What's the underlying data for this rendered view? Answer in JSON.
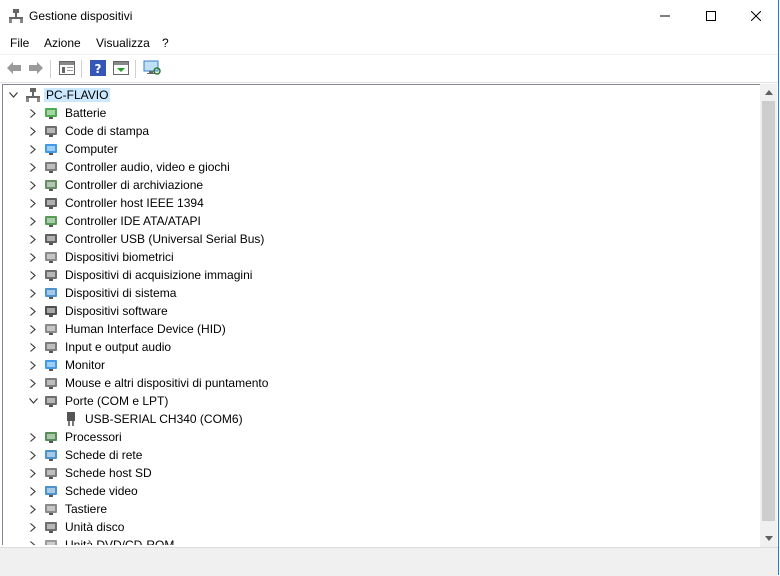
{
  "window": {
    "title": "Gestione dispositivi"
  },
  "menu": {
    "file": "File",
    "azione": "Azione",
    "visualizza": "Visualizza",
    "help": "?"
  },
  "toolbar": {
    "back": "back-arrow-icon",
    "forward": "forward-arrow-icon",
    "properties": "properties-icon",
    "help": "help-icon",
    "update": "update-driver-icon",
    "monitor": "scan-hardware-icon"
  },
  "tree": {
    "root": "PC-FLAVIO",
    "items": [
      {
        "label": "Batterie",
        "icon": "battery-icon",
        "color": "#2e9e2e"
      },
      {
        "label": "Code di stampa",
        "icon": "printer-icon",
        "color": "#555555"
      },
      {
        "label": "Computer",
        "icon": "computer-icon",
        "color": "#1e88e5"
      },
      {
        "label": "Controller audio, video e giochi",
        "icon": "speaker-icon",
        "color": "#666666"
      },
      {
        "label": "Controller di archiviazione",
        "icon": "storage-controller-icon",
        "color": "#4a7a4a"
      },
      {
        "label": "Controller host IEEE 1394",
        "icon": "ieee1394-icon",
        "color": "#444444"
      },
      {
        "label": "Controller IDE ATA/ATAPI",
        "icon": "ide-icon",
        "color": "#3a8a3a"
      },
      {
        "label": "Controller USB (Universal Serial Bus)",
        "icon": "usb-icon",
        "color": "#444444"
      },
      {
        "label": "Dispositivi biometrici",
        "icon": "fingerprint-icon",
        "color": "#777777"
      },
      {
        "label": "Dispositivi di acquisizione immagini",
        "icon": "camera-icon",
        "color": "#555555"
      },
      {
        "label": "Dispositivi di sistema",
        "icon": "system-folder-icon",
        "color": "#2d7fc4"
      },
      {
        "label": "Dispositivi software",
        "icon": "software-device-icon",
        "color": "#333333"
      },
      {
        "label": "Human Interface Device (HID)",
        "icon": "keyboard-hid-icon",
        "color": "#777777"
      },
      {
        "label": "Input e output audio",
        "icon": "audio-io-icon",
        "color": "#666666"
      },
      {
        "label": "Monitor",
        "icon": "monitor-icon",
        "color": "#1e88e5"
      },
      {
        "label": "Mouse e altri dispositivi di puntamento",
        "icon": "mouse-icon",
        "color": "#666666"
      },
      {
        "label": "Porte (COM e LPT)",
        "icon": "port-icon",
        "color": "#555555",
        "expanded": true,
        "children": [
          {
            "label": "USB-SERIAL CH340 (COM6)",
            "icon": "port-icon"
          }
        ]
      },
      {
        "label": "Processori",
        "icon": "processor-icon",
        "color": "#3a7a3a"
      },
      {
        "label": "Schede di rete",
        "icon": "network-adapter-icon",
        "color": "#2d7fc4"
      },
      {
        "label": "Schede host SD",
        "icon": "sd-host-icon",
        "color": "#666666"
      },
      {
        "label": "Schede video",
        "icon": "display-adapter-icon",
        "color": "#2d7fc4"
      },
      {
        "label": "Tastiere",
        "icon": "keyboard-icon",
        "color": "#777777"
      },
      {
        "label": "Unità disco",
        "icon": "disk-drive-icon",
        "color": "#555555"
      },
      {
        "label": "Unità DVD/CD-ROM",
        "icon": "dvd-icon",
        "color": "#888888"
      }
    ]
  }
}
